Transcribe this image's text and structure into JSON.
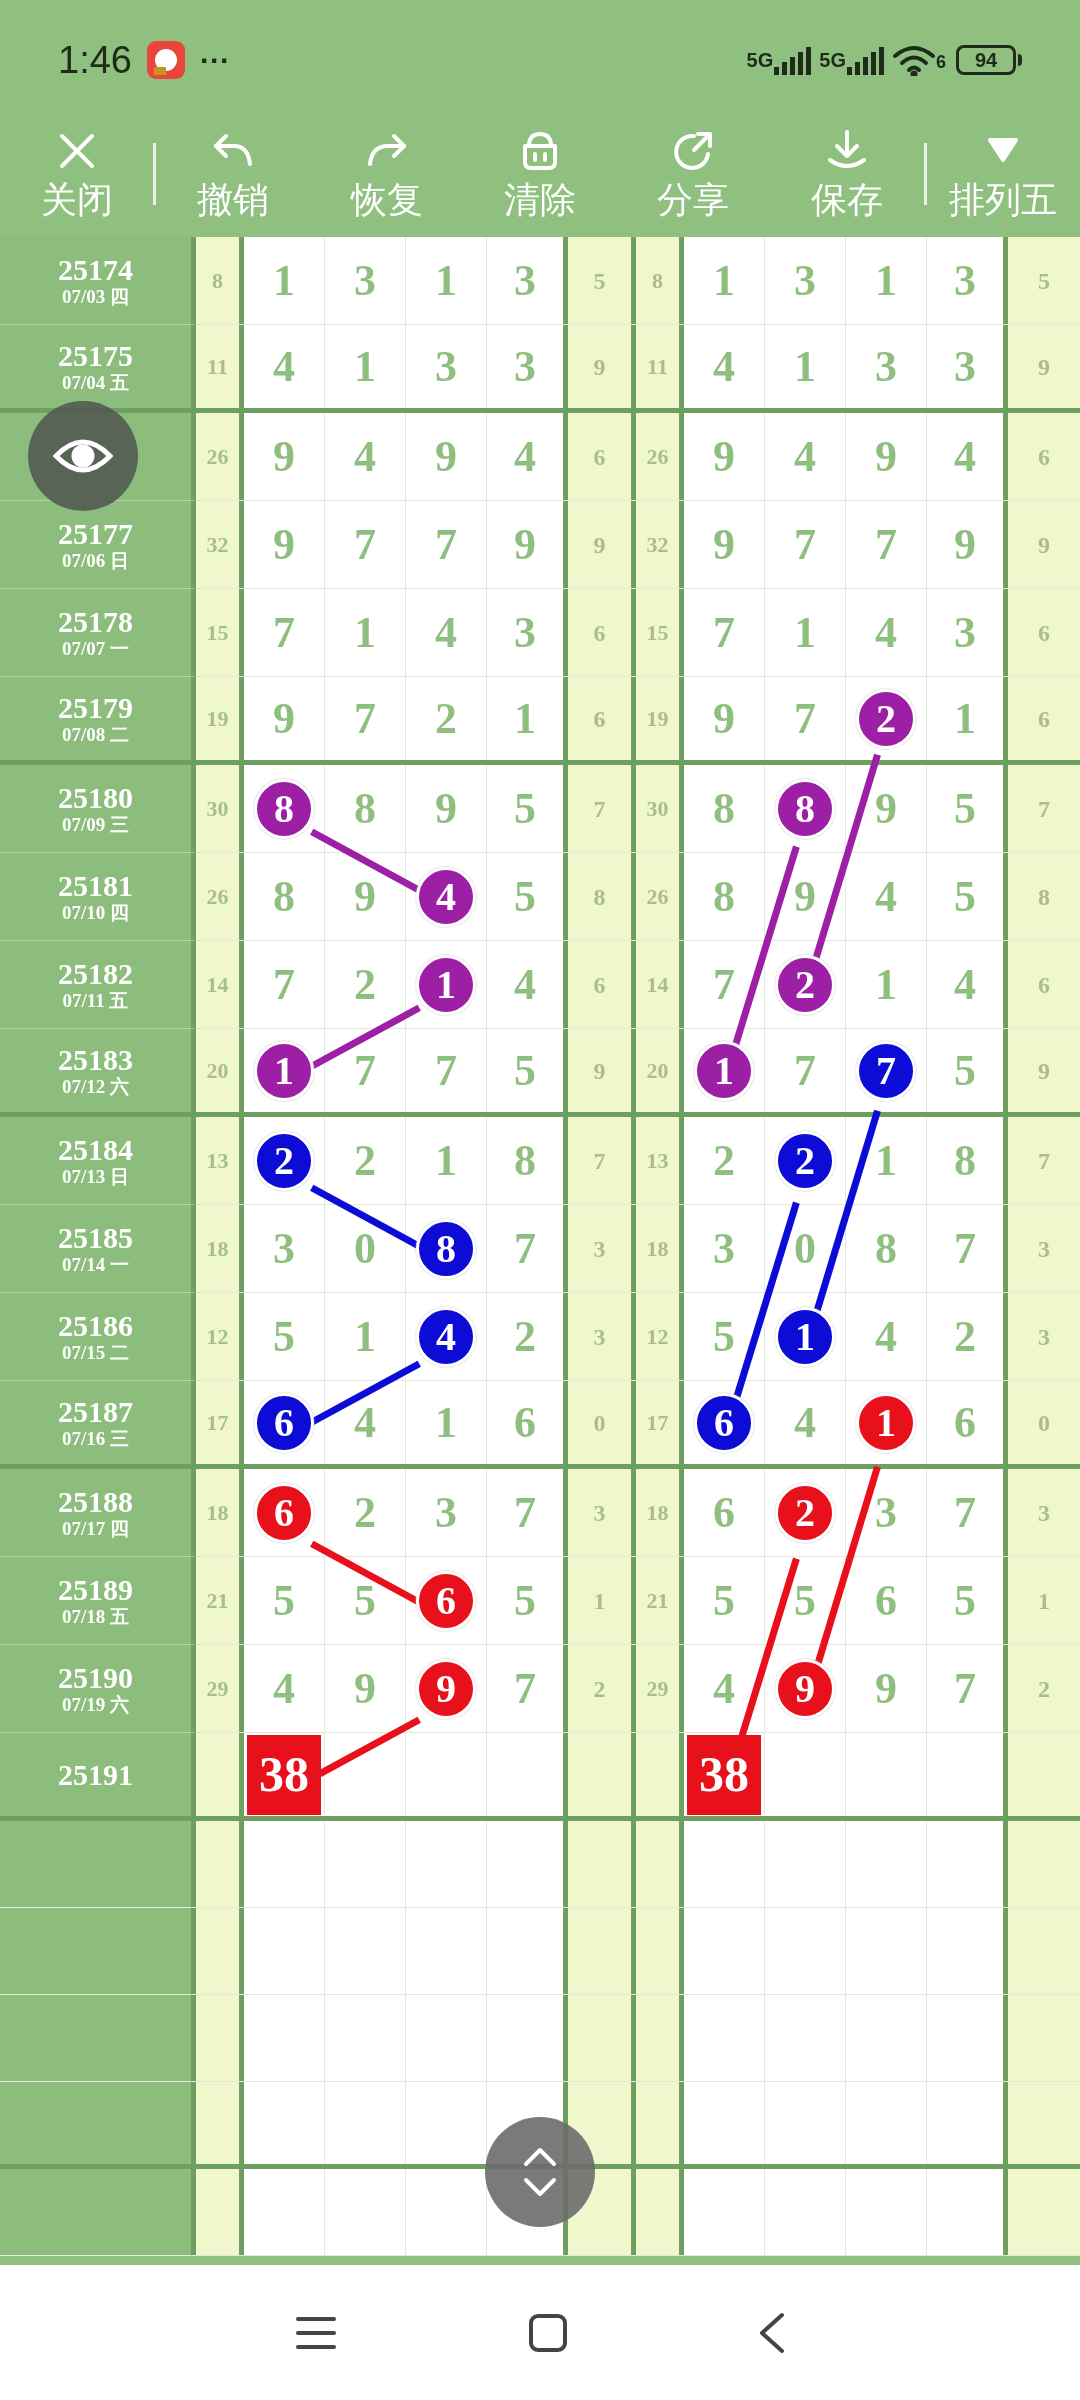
{
  "status_bar": {
    "time": "1:46",
    "more": "···",
    "networks": [
      "5G",
      "5G"
    ],
    "wifi": "6",
    "battery": "94"
  },
  "toolbar": [
    {
      "kind": "close",
      "label": "关闭"
    },
    {
      "kind": "undo",
      "label": "撤销"
    },
    {
      "kind": "redo",
      "label": "恢复"
    },
    {
      "kind": "clear",
      "label": "清除"
    },
    {
      "kind": "share",
      "label": "分享"
    },
    {
      "kind": "save",
      "label": "保存"
    },
    {
      "kind": "menu",
      "label": "排列五"
    }
  ],
  "issues": [
    {
      "issue": "25174",
      "date": "07/03 四"
    },
    {
      "issue": "25175",
      "date": "07/04 五"
    },
    {
      "hidden": true
    },
    {
      "issue": "25177",
      "date": "07/06 日"
    },
    {
      "issue": "25178",
      "date": "07/07 一"
    },
    {
      "issue": "25179",
      "date": "07/08 二"
    },
    {
      "issue": "25180",
      "date": "07/09 三"
    },
    {
      "issue": "25181",
      "date": "07/10 四"
    },
    {
      "issue": "25182",
      "date": "07/11 五"
    },
    {
      "issue": "25183",
      "date": "07/12 六"
    },
    {
      "issue": "25184",
      "date": "07/13 日"
    },
    {
      "issue": "25185",
      "date": "07/14 一"
    },
    {
      "issue": "25186",
      "date": "07/15 二"
    },
    {
      "issue": "25187",
      "date": "07/16 三"
    },
    {
      "issue": "25188",
      "date": "07/17 四"
    },
    {
      "issue": "25189",
      "date": "07/18 五"
    },
    {
      "issue": "25190",
      "date": "07/19 六"
    },
    {
      "issue": "25191"
    }
  ],
  "panels": [
    {
      "rows": [
        {
          "sum": "8",
          "digits": [
            {
              "kind": "plain",
              "value": "1"
            },
            {
              "kind": "plain",
              "value": "3"
            },
            {
              "kind": "plain",
              "value": "1"
            },
            {
              "kind": "plain",
              "value": "3"
            }
          ],
          "extra": "5"
        },
        {
          "sum": "11",
          "digits": [
            {
              "kind": "plain",
              "value": "4"
            },
            {
              "kind": "plain",
              "value": "1"
            },
            {
              "kind": "plain",
              "value": "3"
            },
            {
              "kind": "plain",
              "value": "3"
            }
          ],
          "extra": "9"
        },
        {
          "sum": "26",
          "digits": [
            {
              "kind": "plain",
              "value": "9"
            },
            {
              "kind": "plain",
              "value": "4"
            },
            {
              "kind": "plain",
              "value": "9"
            },
            {
              "kind": "plain",
              "value": "4"
            }
          ],
          "extra": "6"
        },
        {
          "sum": "32",
          "digits": [
            {
              "kind": "plain",
              "value": "9"
            },
            {
              "kind": "plain",
              "value": "7"
            },
            {
              "kind": "plain",
              "value": "7"
            },
            {
              "kind": "plain",
              "value": "9"
            }
          ],
          "extra": "9"
        },
        {
          "sum": "15",
          "digits": [
            {
              "kind": "plain",
              "value": "7"
            },
            {
              "kind": "plain",
              "value": "1"
            },
            {
              "kind": "plain",
              "value": "4"
            },
            {
              "kind": "plain",
              "value": "3"
            }
          ],
          "extra": "6"
        },
        {
          "sum": "19",
          "digits": [
            {
              "kind": "plain",
              "value": "9"
            },
            {
              "kind": "plain",
              "value": "7"
            },
            {
              "kind": "plain",
              "value": "2"
            },
            {
              "kind": "plain",
              "value": "1"
            }
          ],
          "extra": "6"
        },
        {
          "sum": "30",
          "digits": [
            {
              "kind": "ball",
              "value": "8",
              "color": "#9c1fa6"
            },
            {
              "kind": "plain",
              "value": "8"
            },
            {
              "kind": "plain",
              "value": "9"
            },
            {
              "kind": "plain",
              "value": "5"
            }
          ],
          "extra": "7"
        },
        {
          "sum": "26",
          "digits": [
            {
              "kind": "plain",
              "value": "8"
            },
            {
              "kind": "plain",
              "value": "9"
            },
            {
              "kind": "ball",
              "value": "4",
              "color": "#9c1fa6"
            },
            {
              "kind": "plain",
              "value": "5"
            }
          ],
          "extra": "8"
        },
        {
          "sum": "14",
          "digits": [
            {
              "kind": "plain",
              "value": "7"
            },
            {
              "kind": "plain",
              "value": "2"
            },
            {
              "kind": "ball",
              "value": "1",
              "color": "#9c1fa6"
            },
            {
              "kind": "plain",
              "value": "4"
            }
          ],
          "extra": "6"
        },
        {
          "sum": "20",
          "digits": [
            {
              "kind": "ball",
              "value": "1",
              "color": "#9c1fa6"
            },
            {
              "kind": "plain",
              "value": "7"
            },
            {
              "kind": "plain",
              "value": "7"
            },
            {
              "kind": "plain",
              "value": "5"
            }
          ],
          "extra": "9"
        },
        {
          "sum": "13",
          "digits": [
            {
              "kind": "ball",
              "value": "2",
              "color": "#0c0cd6"
            },
            {
              "kind": "plain",
              "value": "2"
            },
            {
              "kind": "plain",
              "value": "1"
            },
            {
              "kind": "plain",
              "value": "8"
            }
          ],
          "extra": "7"
        },
        {
          "sum": "18",
          "digits": [
            {
              "kind": "plain",
              "value": "3"
            },
            {
              "kind": "plain",
              "value": "0"
            },
            {
              "kind": "ball",
              "value": "8",
              "color": "#0c0cd6"
            },
            {
              "kind": "plain",
              "value": "7"
            }
          ],
          "extra": "3"
        },
        {
          "sum": "12",
          "digits": [
            {
              "kind": "plain",
              "value": "5"
            },
            {
              "kind": "plain",
              "value": "1"
            },
            {
              "kind": "ball",
              "value": "4",
              "color": "#0c0cd6"
            },
            {
              "kind": "plain",
              "value": "2"
            }
          ],
          "extra": "3"
        },
        {
          "sum": "17",
          "digits": [
            {
              "kind": "ball",
              "value": "6",
              "color": "#0c0cd6"
            },
            {
              "kind": "plain",
              "value": "4"
            },
            {
              "kind": "plain",
              "value": "1"
            },
            {
              "kind": "plain",
              "value": "6"
            }
          ],
          "extra": "0"
        },
        {
          "sum": "18",
          "digits": [
            {
              "kind": "ball",
              "value": "6",
              "color": "#e8101a"
            },
            {
              "kind": "plain",
              "value": "2"
            },
            {
              "kind": "plain",
              "value": "3"
            },
            {
              "kind": "plain",
              "value": "7"
            }
          ],
          "extra": "3"
        },
        {
          "sum": "21",
          "digits": [
            {
              "kind": "plain",
              "value": "5"
            },
            {
              "kind": "plain",
              "value": "5"
            },
            {
              "kind": "ball",
              "value": "6",
              "color": "#e8101a"
            },
            {
              "kind": "plain",
              "value": "5"
            }
          ],
          "extra": "1"
        },
        {
          "sum": "29",
          "digits": [
            {
              "kind": "plain",
              "value": "4"
            },
            {
              "kind": "plain",
              "value": "9"
            },
            {
              "kind": "ball",
              "value": "9",
              "color": "#e8101a"
            },
            {
              "kind": "plain",
              "value": "7"
            }
          ],
          "extra": "2"
        },
        {
          "digits": [
            {
              "kind": "box",
              "value": "38",
              "color": "#e8101a"
            }
          ]
        }
      ],
      "kind": "paired"
    },
    {
      "rows": [
        {
          "sum": "8",
          "digits": [
            {
              "kind": "plain",
              "value": "1"
            },
            {
              "kind": "plain",
              "value": "3"
            },
            {
              "kind": "plain",
              "value": "1"
            },
            {
              "kind": "plain",
              "value": "3"
            }
          ],
          "extra": "5"
        },
        {
          "sum": "11",
          "digits": [
            {
              "kind": "plain",
              "value": "4"
            },
            {
              "kind": "plain",
              "value": "1"
            },
            {
              "kind": "plain",
              "value": "3"
            },
            {
              "kind": "plain",
              "value": "3"
            }
          ],
          "extra": "9"
        },
        {
          "sum": "26",
          "digits": [
            {
              "kind": "plain",
              "value": "9"
            },
            {
              "kind": "plain",
              "value": "4"
            },
            {
              "kind": "plain",
              "value": "9"
            },
            {
              "kind": "plain",
              "value": "4"
            }
          ],
          "extra": "6"
        },
        {
          "sum": "32",
          "digits": [
            {
              "kind": "plain",
              "value": "9"
            },
            {
              "kind": "plain",
              "value": "7"
            },
            {
              "kind": "plain",
              "value": "7"
            },
            {
              "kind": "plain",
              "value": "9"
            }
          ],
          "extra": "9"
        },
        {
          "sum": "15",
          "digits": [
            {
              "kind": "plain",
              "value": "7"
            },
            {
              "kind": "plain",
              "value": "1"
            },
            {
              "kind": "plain",
              "value": "4"
            },
            {
              "kind": "plain",
              "value": "3"
            }
          ],
          "extra": "6"
        },
        {
          "sum": "19",
          "digits": [
            {
              "kind": "plain",
              "value": "9"
            },
            {
              "kind": "plain",
              "value": "7"
            },
            {
              "kind": "ball",
              "value": "2",
              "color": "#9c1fa6"
            },
            {
              "kind": "plain",
              "value": "1"
            }
          ],
          "extra": "6"
        },
        {
          "sum": "30",
          "digits": [
            {
              "kind": "plain",
              "value": "8"
            },
            {
              "kind": "ball",
              "value": "8",
              "color": "#9c1fa6"
            },
            {
              "kind": "plain",
              "value": "9"
            },
            {
              "kind": "plain",
              "value": "5"
            }
          ],
          "extra": "7"
        },
        {
          "sum": "26",
          "digits": [
            {
              "kind": "plain",
              "value": "8"
            },
            {
              "kind": "plain",
              "value": "9"
            },
            {
              "kind": "plain",
              "value": "4"
            },
            {
              "kind": "plain",
              "value": "5"
            }
          ],
          "extra": "8"
        },
        {
          "sum": "14",
          "digits": [
            {
              "kind": "plain",
              "value": "7"
            },
            {
              "kind": "ball",
              "value": "2",
              "color": "#9c1fa6"
            },
            {
              "kind": "plain",
              "value": "1"
            },
            {
              "kind": "plain",
              "value": "4"
            }
          ],
          "extra": "6"
        },
        {
          "sum": "20",
          "digits": [
            {
              "kind": "ball",
              "value": "1",
              "color": "#9c1fa6"
            },
            {
              "kind": "plain",
              "value": "7"
            },
            {
              "kind": "ball",
              "value": "7",
              "color": "#0c0cd6"
            },
            {
              "kind": "plain",
              "value": "5"
            }
          ],
          "extra": "9"
        },
        {
          "sum": "13",
          "digits": [
            {
              "kind": "plain",
              "value": "2"
            },
            {
              "kind": "ball",
              "value": "2",
              "color": "#0c0cd6"
            },
            {
              "kind": "plain",
              "value": "1"
            },
            {
              "kind": "plain",
              "value": "8"
            }
          ],
          "extra": "7"
        },
        {
          "sum": "18",
          "digits": [
            {
              "kind": "plain",
              "value": "3"
            },
            {
              "kind": "plain",
              "value": "0"
            },
            {
              "kind": "plain",
              "value": "8"
            },
            {
              "kind": "plain",
              "value": "7"
            }
          ],
          "extra": "3"
        },
        {
          "sum": "12",
          "digits": [
            {
              "kind": "plain",
              "value": "5"
            },
            {
              "kind": "ball",
              "value": "1",
              "color": "#0c0cd6"
            },
            {
              "kind": "plain",
              "value": "4"
            },
            {
              "kind": "plain",
              "value": "2"
            }
          ],
          "extra": "3"
        },
        {
          "sum": "17",
          "digits": [
            {
              "kind": "ball",
              "value": "6",
              "color": "#0c0cd6"
            },
            {
              "kind": "plain",
              "value": "4"
            },
            {
              "kind": "ball",
              "value": "1",
              "color": "#e8101a"
            },
            {
              "kind": "plain",
              "value": "6"
            }
          ],
          "extra": "0"
        },
        {
          "sum": "18",
          "digits": [
            {
              "kind": "plain",
              "value": "6"
            },
            {
              "kind": "ball",
              "value": "2",
              "color": "#e8101a"
            },
            {
              "kind": "plain",
              "value": "3"
            },
            {
              "kind": "plain",
              "value": "7"
            }
          ],
          "extra": "3"
        },
        {
          "sum": "21",
          "digits": [
            {
              "kind": "plain",
              "value": "5"
            },
            {
              "kind": "plain",
              "value": "5"
            },
            {
              "kind": "plain",
              "value": "6"
            },
            {
              "kind": "plain",
              "value": "5"
            }
          ],
          "extra": "1"
        },
        {
          "sum": "29",
          "digits": [
            {
              "kind": "plain",
              "value": "4"
            },
            {
              "kind": "ball",
              "value": "9",
              "color": "#e8101a"
            },
            {
              "kind": "plain",
              "value": "9"
            },
            {
              "kind": "plain",
              "value": "7"
            }
          ],
          "extra": "2"
        },
        {
          "digits": [
            {
              "kind": "box",
              "value": "38",
              "color": "#e8101a"
            }
          ]
        }
      ],
      "kind": "crossed"
    }
  ]
}
